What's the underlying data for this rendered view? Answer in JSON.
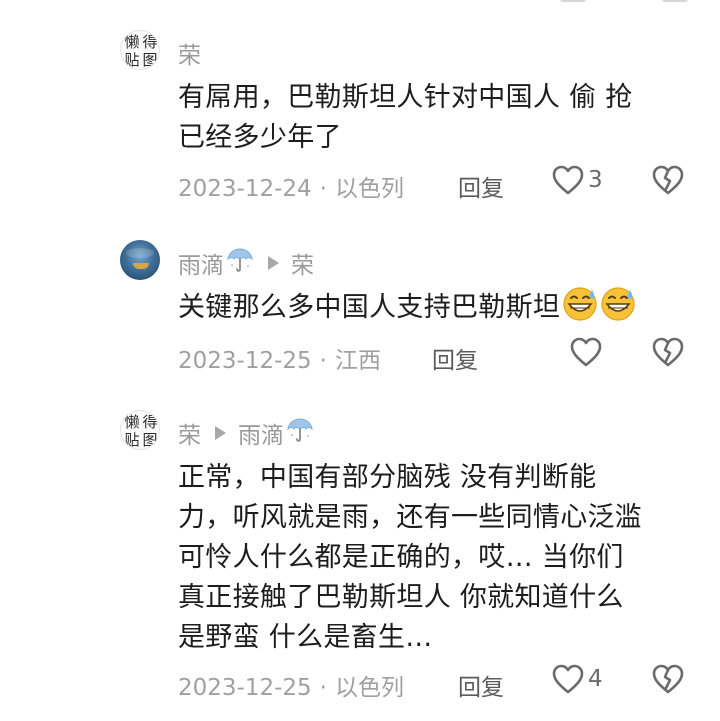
{
  "comments": [
    {
      "avatar_text": "懒得贴图",
      "author": "荣",
      "reply_to": "",
      "text": "有屌用，巴勒斯坦人针对中国人 偷 抢\n已经多少年了",
      "date": "2023-12-24",
      "location": "以色列",
      "reply_label": "回复",
      "likes": "3"
    },
    {
      "avatar_text": "",
      "author": "雨滴",
      "reply_to": "荣",
      "text": "关键那么多中国人支持巴勒斯坦",
      "date": "2023-12-25",
      "location": "江西",
      "reply_label": "回复",
      "likes": ""
    },
    {
      "avatar_text": "懒得贴图",
      "author": "荣",
      "reply_to": "雨滴",
      "text": "正常，中国有部分脑残 没有判断能\n力，听风就是雨，还有一些同情心泛滥\n可怜人什么都是正确的，哎… 当你们\n真正接触了巴勒斯坦人 你就知道什么\n是野蛮 什么是畜生…",
      "date": "2023-12-25",
      "location": "以色列",
      "reply_label": "回复",
      "likes": "4"
    }
  ],
  "separator_dot": "·",
  "icons": {
    "like": "heart-outline-icon",
    "dislike": "broken-heart-icon",
    "umbrella": "umbrella-icon",
    "emoji": "grinning-sweat-emoji"
  },
  "colors": {
    "meta_text": "#a0a0a0",
    "author_text": "#9a9a9a",
    "body_text": "#1d1d1d",
    "reply_text": "#5b5b5b"
  }
}
